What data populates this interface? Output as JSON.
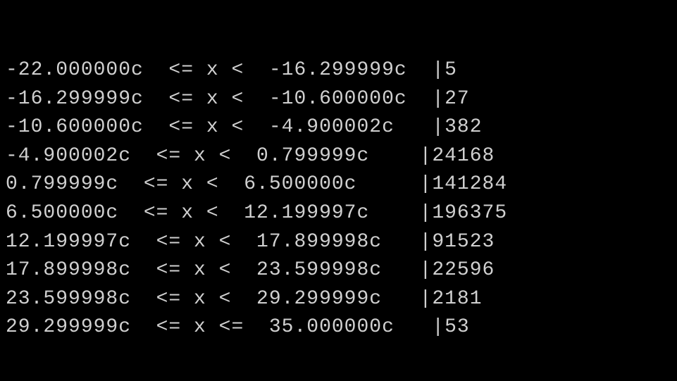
{
  "histogram": {
    "rows": [
      {
        "lower": "-22.000000c",
        "op": "<= x <",
        "upper": "-16.299999c",
        "count": "5",
        "upper_pad": "  ",
        "range_suffix": "  ",
        "lower_pad": "",
        "op_pad": "  "
      },
      {
        "lower": "-16.299999c",
        "op": "<= x <",
        "upper": "-10.600000c",
        "count": "27",
        "upper_pad": "  ",
        "range_suffix": "  ",
        "lower_pad": "",
        "op_pad": "  "
      },
      {
        "lower": "-10.600000c",
        "op": "<= x <",
        "upper": "-4.900002c",
        "count": "382",
        "upper_pad": "  ",
        "range_suffix": "   ",
        "lower_pad": "",
        "op_pad": "  "
      },
      {
        "lower": "-4.900002c",
        "op": "<= x <",
        "upper": "0.799999c",
        "count": "24168",
        "upper_pad": "  ",
        "range_suffix": "    ",
        "lower_pad": "",
        "op_pad": "  "
      },
      {
        "lower": "0.799999c",
        "op": "<= x <",
        "upper": "6.500000c",
        "count": "141284",
        "upper_pad": "  ",
        "range_suffix": "     ",
        "lower_pad": "",
        "op_pad": "  "
      },
      {
        "lower": "6.500000c",
        "op": "<= x <",
        "upper": "12.199997c",
        "count": "196375",
        "upper_pad": "  ",
        "range_suffix": "    ",
        "lower_pad": "",
        "op_pad": "  "
      },
      {
        "lower": "12.199997c",
        "op": "<= x <",
        "upper": "17.899998c",
        "count": "91523",
        "upper_pad": "  ",
        "range_suffix": "   ",
        "lower_pad": "",
        "op_pad": "  "
      },
      {
        "lower": "17.899998c",
        "op": "<= x <",
        "upper": "23.599998c",
        "count": "22596",
        "upper_pad": "  ",
        "range_suffix": "   ",
        "lower_pad": "",
        "op_pad": "  "
      },
      {
        "lower": "23.599998c",
        "op": "<= x <",
        "upper": "29.299999c",
        "count": "2181",
        "upper_pad": "  ",
        "range_suffix": "   ",
        "lower_pad": "",
        "op_pad": "  "
      },
      {
        "lower": "29.299999c",
        "op": "<= x <=",
        "upper": "35.000000c",
        "count": "53",
        "upper_pad": "  ",
        "range_suffix": "   ",
        "lower_pad": "",
        "op_pad": "  "
      }
    ],
    "separator": "|"
  },
  "chart_data": {
    "type": "table",
    "title": "Temperature histogram (°C)",
    "columns": [
      "lower_bound",
      "upper_bound",
      "upper_inclusive",
      "count"
    ],
    "rows": [
      [
        "-22.000000",
        "-16.299999",
        false,
        5
      ],
      [
        "-16.299999",
        "-10.600000",
        false,
        27
      ],
      [
        "-10.600000",
        "-4.900002",
        false,
        382
      ],
      [
        "-4.900002",
        "0.799999",
        false,
        24168
      ],
      [
        "0.799999",
        "6.500000",
        false,
        141284
      ],
      [
        "6.500000",
        "12.199997",
        false,
        196375
      ],
      [
        "12.199997",
        "17.899998",
        false,
        91523
      ],
      [
        "17.899998",
        "23.599998",
        false,
        22596
      ],
      [
        "23.599998",
        "29.299999",
        false,
        2181
      ],
      [
        "29.299999",
        "35.000000",
        true,
        53
      ]
    ]
  }
}
